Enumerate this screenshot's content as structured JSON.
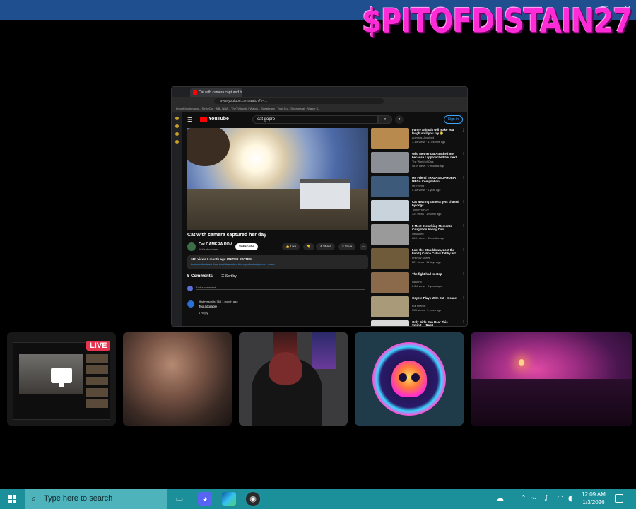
{
  "overlay": {
    "brand_text": "$PITOFDISTAIN27",
    "brand_color": "#ff2bd6",
    "window_controls": [
      "minimize-icon",
      "maximize-icon",
      "close-icon"
    ]
  },
  "browser": {
    "tab_title": "Cat with camera captured h",
    "url": "www.youtube.com/watch?v=...",
    "bookmarks": "Import bookmarks...   StrikeOut · NBL NBA...   TheTVApp.to | Watch...   Speakeasy · Your Cu...   Streameast · Watch S...",
    "youtube": {
      "logo": "YouTube",
      "search_value": "cat gopro",
      "sign_in": "Sign in",
      "video_title": "Cat with camera captured her day",
      "channel_name": "Cat CAMERA POV",
      "subscribers": "194 subscribers",
      "subscribe_label": "Subscribe",
      "like_label": "Like",
      "share_label": "Share",
      "save_label": "Save",
      "desc_line1": "11K views  1 month ago  UNITED STATES",
      "desc_line2": "#catpov #catcam #cat #cat #catvideo #funnycats #catgopro ...more",
      "comments_count": "5 Comments",
      "sort_label": "Sort by",
      "add_comment_placeholder": "Add a comment...",
      "comment": {
        "user": "@stevesmith4765  1 month ago",
        "text": "Too adorable",
        "actions": "1     Reply"
      },
      "recommendations": [
        {
          "title": "Funny animals will make you laugh until you cry 😂",
          "channel": "Animalis Unsolved",
          "meta": "1.1M views · 11 months ago",
          "thumb": "#b88a4e"
        },
        {
          "title": "Wild mother cat Attacked me because I approached her next...",
          "channel": "The World of Cats",
          "meta": "981K views · 7 months ago",
          "thumb": "#8b8f95"
        },
        {
          "title": "Mr. Friend THALASSOPHOBIA MEGA Compilation",
          "channel": "Mr. Friend",
          "meta": "4.1M views · 1 year ago",
          "thumb": "#3d5a7a"
        },
        {
          "title": "Cat wearing camera gets chased by dogs",
          "channel": "Tommy's POV",
          "meta": "324 views · 1 month ago",
          "thumb": "#c9d3dc"
        },
        {
          "title": "8 Most Disturbing Moments Caught on Nanny Cam",
          "channel": "Obscured",
          "meta": "869K views · 2 months ago",
          "thumb": "#9a9a9a"
        },
        {
          "title": "Lost the Standdown, Lost the Food | Calico Cat vs Tabby wit...",
          "channel": "Friendly Strays",
          "meta": "221 views · 11 days ago",
          "thumb": "#6f5a3a"
        },
        {
          "title": "The fight had to stop",
          "channel": "Nalu Ho",
          "meta": "2.3M views · 4 years ago",
          "thumb": "#8a6a4a"
        },
        {
          "title": "Coyote Plays With Cat - Insane",
          "channel": "Fur Friends",
          "meta": "50M views · 3 years ago",
          "thumb": "#a99a7a"
        },
        {
          "title": "Only Girls Can Hear This Sound... (Real)",
          "channel": "",
          "meta": "",
          "thumb": "#d9d9d9"
        }
      ]
    }
  },
  "webcams": {
    "live_label": "LIVE",
    "tiles": [
      "screen-share",
      "cam-woman",
      "cam-hooded-person",
      "cam-skull-avatar",
      "cam-pink-room"
    ]
  },
  "taskbar": {
    "search_placeholder": "Type here to search",
    "time": "12:09 AM",
    "date": "1/3/2026",
    "apps": [
      "task-view-icon",
      "discord-icon",
      "edge-icon",
      "obs-icon"
    ],
    "tray_icons": [
      "weather-icon",
      "chevron-up-icon",
      "network-icon",
      "microphone-icon",
      "wifi-icon",
      "volume-icon",
      "notification-icon"
    ],
    "accent": "#1b8f9a"
  }
}
